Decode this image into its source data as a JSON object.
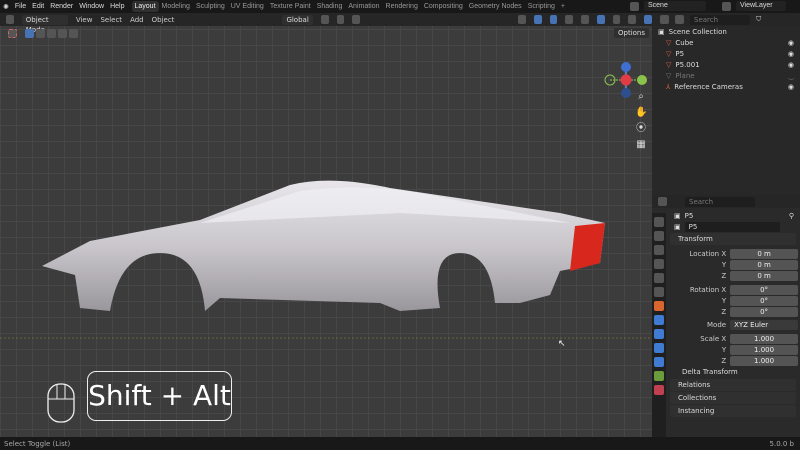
{
  "menu": [
    "File",
    "Edit",
    "Render",
    "Window",
    "Help"
  ],
  "workspaces": [
    "Layout",
    "Modeling",
    "Sculpting",
    "UV Editing",
    "Texture Paint",
    "Shading",
    "Animation",
    "Rendering",
    "Compositing",
    "Geometry Nodes",
    "Scripting"
  ],
  "scene": "Scene",
  "view_layer": "ViewLayer",
  "viewport_header": {
    "mode": "Object Mode",
    "view": "View",
    "select": "Select",
    "add": "Add",
    "object": "Object",
    "orientation": "Global",
    "options": "Options"
  },
  "gizmo": {
    "z": "Z",
    "x": "X",
    "y": "Y"
  },
  "overlay": {
    "keys": "Shift + Alt"
  },
  "outliner": {
    "search_placeholder": "Search",
    "root": "Scene Collection",
    "items": [
      "Cube",
      "P5",
      "P5.001",
      "Plane",
      "Reference Cameras"
    ]
  },
  "properties": {
    "search_placeholder": "Search",
    "object_name": "P5",
    "data_name": "P5",
    "transform_label": "Transform",
    "location": {
      "label": "Location X",
      "x": "0 m",
      "y": "0 m",
      "z": "0 m"
    },
    "rotation": {
      "label": "Rotation X",
      "x": "0°",
      "y": "0°",
      "z": "0°"
    },
    "mode_label": "Mode",
    "mode": "XYZ Euler",
    "scale": {
      "label": "Scale X",
      "x": "1.000",
      "y": "1.000",
      "z": "1.000"
    },
    "axis": {
      "y": "Y",
      "z": "Z"
    },
    "sections": [
      "Delta Transform",
      "Relations",
      "Collections",
      "Instancing"
    ]
  },
  "status": {
    "left": "Select Toggle (List)",
    "version": "5.0.0 b"
  },
  "colors": {
    "accent": "#4772b3",
    "x_axis": "#e03c46",
    "y_axis": "#8bc34a",
    "z_axis": "#3f6fd1"
  }
}
